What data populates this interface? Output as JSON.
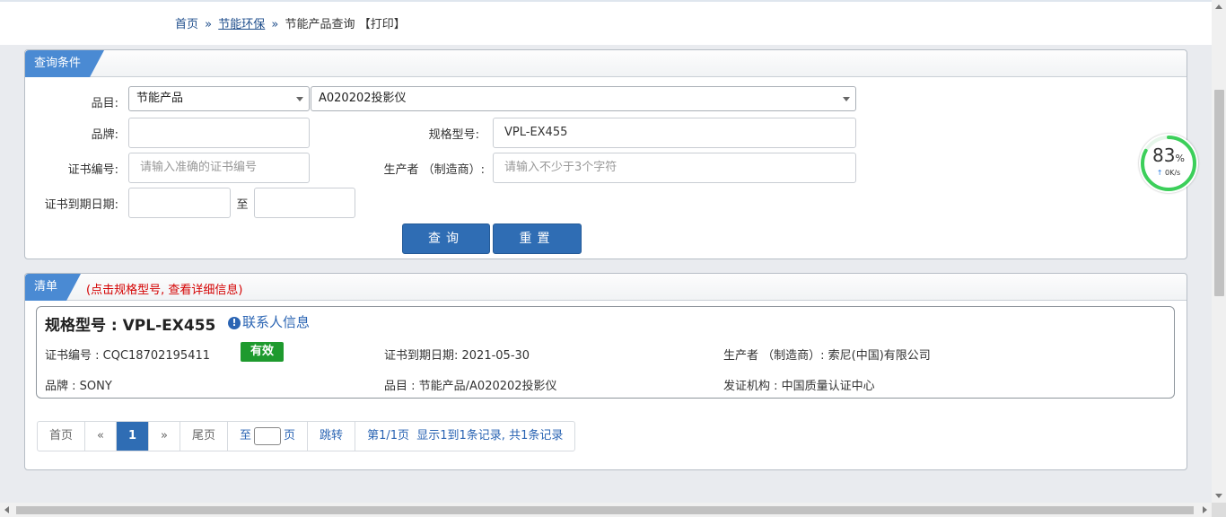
{
  "breadcrumb": {
    "home": "首页",
    "sep": "»",
    "category": "节能环保",
    "current": "节能产品查询",
    "print": "【打印】"
  },
  "query": {
    "title": "查询条件",
    "category_label": "品目:",
    "category_select": "节能产品",
    "subcategory_select": "A020202投影仪",
    "brand_label": "品牌:",
    "brand_value": "",
    "model_label": "规格型号:",
    "model_value": "VPL-EX455",
    "cert_label": "证书编号:",
    "cert_placeholder": "请输入准确的证书编号",
    "maker_label": "生产者 （制造商）:",
    "maker_placeholder": "请输入不少于3个字符",
    "expiry_label": "证书到期日期:",
    "expiry_to": "至",
    "search_button": "查询",
    "reset_button": "重置"
  },
  "list": {
    "title": "清单",
    "note": "(点击规格型号, 查看详细信息)",
    "items": [
      {
        "model": "规格型号 : VPL-EX455",
        "contact": "联系人信息",
        "cert": "证书编号 : CQC18702195411",
        "status": "有效",
        "expiry": "证书到期日期: 2021-05-30",
        "maker": "生产者 （制造商）: 索尼(中国)有限公司",
        "brand": "品牌 : SONY",
        "category": "品目 : 节能产品/A020202投影仪",
        "issuer": "发证机构 : 中国质量认证中心"
      }
    ]
  },
  "pager": {
    "first": "首页",
    "prev": "«",
    "current": "1",
    "next": "»",
    "last": "尾页",
    "to": "至",
    "page_unit": "页",
    "jump": "跳转",
    "page_info": "第1/1页",
    "records": "显示1到1条记录, 共1条记录"
  },
  "speed_widget": {
    "percent": "83",
    "percent_unit": "%",
    "arrow": "↑",
    "rate": "0K/s",
    "ring_fraction": 0.83,
    "ring_color": "#3ccf5a"
  },
  "colors": {
    "accent": "#2f6db4",
    "tab": "#4a8ad3",
    "valid": "#1e9a2e",
    "note": "#d40000"
  }
}
